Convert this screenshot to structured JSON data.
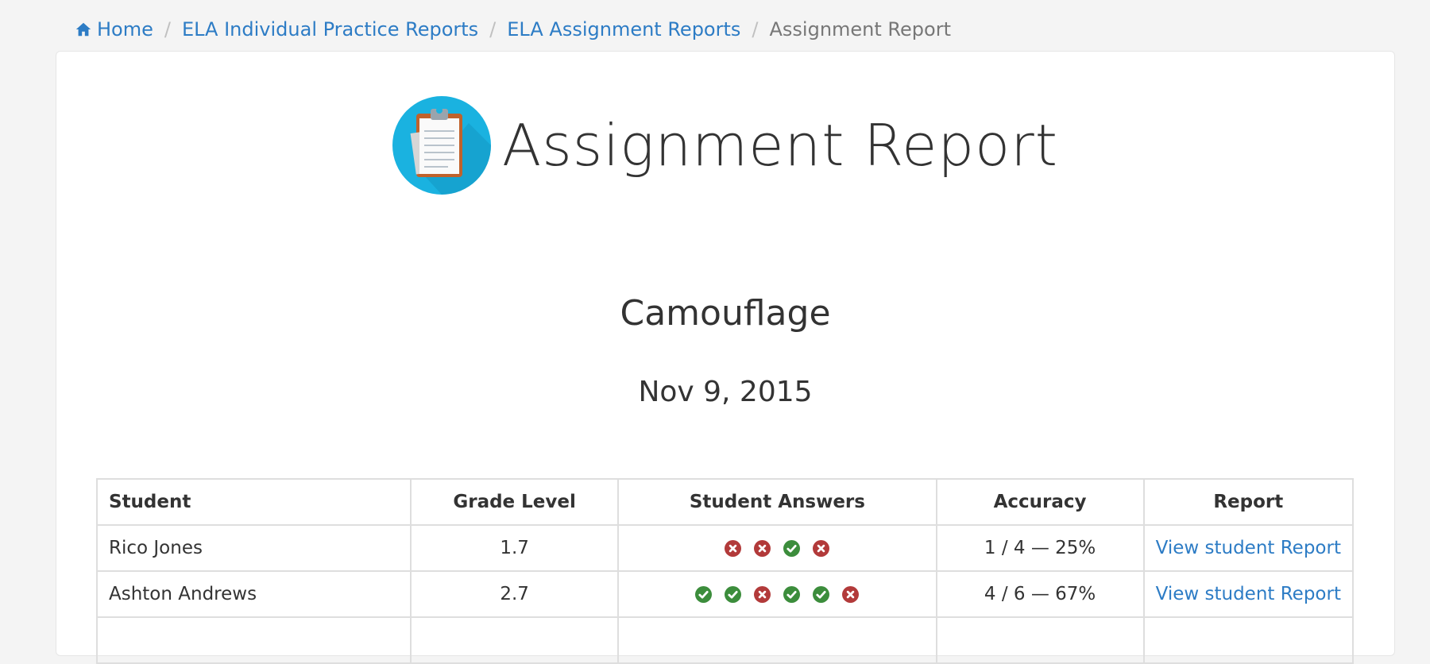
{
  "breadcrumb": {
    "home_icon": "home-icon",
    "home": "Home",
    "items": [
      "ELA Individual Practice Reports",
      "ELA Assignment Reports"
    ],
    "current": "Assignment Report"
  },
  "header": {
    "icon": "clipboard-icon",
    "title": "Assignment Report"
  },
  "assignment": {
    "name": "Camouflage",
    "date": "Nov 9, 2015"
  },
  "colors": {
    "link": "#2d7cc5",
    "correct": "#3c8d3c",
    "incorrect": "#b23a3a",
    "icon_circle": "#1ab2e0"
  },
  "table": {
    "headers": [
      "Student",
      "Grade Level",
      "Student Answers",
      "Accuracy",
      "Report"
    ],
    "rows": [
      {
        "student": "Rico Jones",
        "grade": "1.7",
        "answers": [
          "incorrect",
          "incorrect",
          "correct",
          "incorrect"
        ],
        "accuracy": "1 / 4 — 25%",
        "report": "View student Report"
      },
      {
        "student": "Ashton Andrews",
        "grade": "2.7",
        "answers": [
          "correct",
          "correct",
          "incorrect",
          "correct",
          "correct",
          "incorrect"
        ],
        "accuracy": "4 / 6 — 67%",
        "report": "View student Report"
      }
    ]
  }
}
